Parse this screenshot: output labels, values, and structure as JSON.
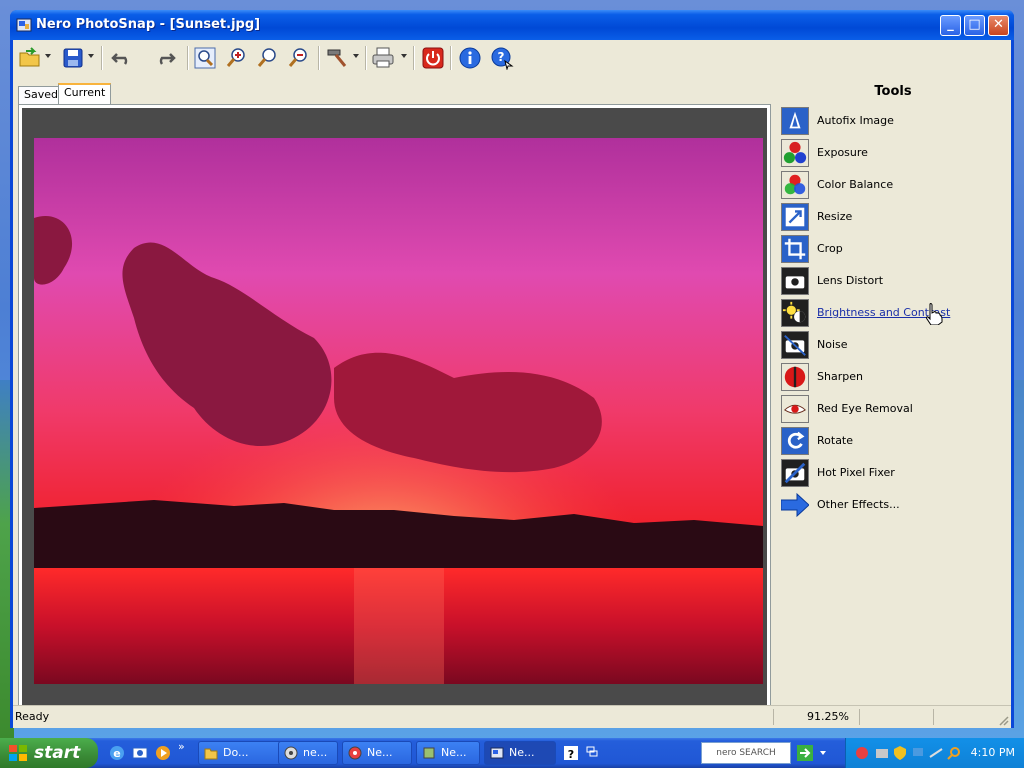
{
  "window": {
    "title": "Nero PhotoSnap - [Sunset.jpg]",
    "controls": [
      "minimize",
      "maximize",
      "close"
    ]
  },
  "toolbar": {
    "icons": [
      "open-icon",
      "save-icon",
      "undo-icon",
      "redo-icon",
      "zoom-fit-icon",
      "zoom-in-icon",
      "zoom-actual-icon",
      "zoom-out-icon",
      "tools-hammer-icon",
      "print-icon",
      "exit-icon",
      "info-icon",
      "help-icon"
    ]
  },
  "tabs": [
    {
      "label": "Saved"
    },
    {
      "label": "Current",
      "selected": true
    }
  ],
  "tools_panel": {
    "title": "Tools",
    "items": [
      {
        "label": "Autofix Image",
        "icon": "autofix-icon"
      },
      {
        "label": "Exposure",
        "icon": "exposure-icon"
      },
      {
        "label": "Color Balance",
        "icon": "color-balance-icon"
      },
      {
        "label": "Resize",
        "icon": "resize-icon"
      },
      {
        "label": "Crop",
        "icon": "crop-icon"
      },
      {
        "label": "Lens Distort",
        "icon": "lens-distort-icon"
      },
      {
        "label": "Brightness and Contrast",
        "icon": "brightness-contrast-icon",
        "hovered": true
      },
      {
        "label": "Noise",
        "icon": "noise-icon"
      },
      {
        "label": "Sharpen",
        "icon": "sharpen-icon"
      },
      {
        "label": "Red Eye Removal",
        "icon": "red-eye-icon"
      },
      {
        "label": "Rotate",
        "icon": "rotate-icon"
      },
      {
        "label": "Hot Pixel Fixer",
        "icon": "hot-pixel-icon"
      },
      {
        "label": "Other Effects...",
        "icon": "arrow-right-icon"
      }
    ]
  },
  "status": {
    "text": "Ready",
    "zoom": "91.25%"
  },
  "taskbar": {
    "start_label": "start",
    "tasks": [
      {
        "label": "Do..."
      },
      {
        "label": "ne..."
      },
      {
        "label": "Ne..."
      },
      {
        "label": "Ne..."
      },
      {
        "label": "Ne...",
        "active": true
      }
    ],
    "search_label": "nero SEARCH",
    "clock": "4:10 PM"
  },
  "colors": {
    "titlebar": "#0049d6",
    "client": "#ece9d8",
    "taskbar": "#245edb",
    "start": "#3a8a36",
    "link_hover": "#1a2fa8"
  }
}
